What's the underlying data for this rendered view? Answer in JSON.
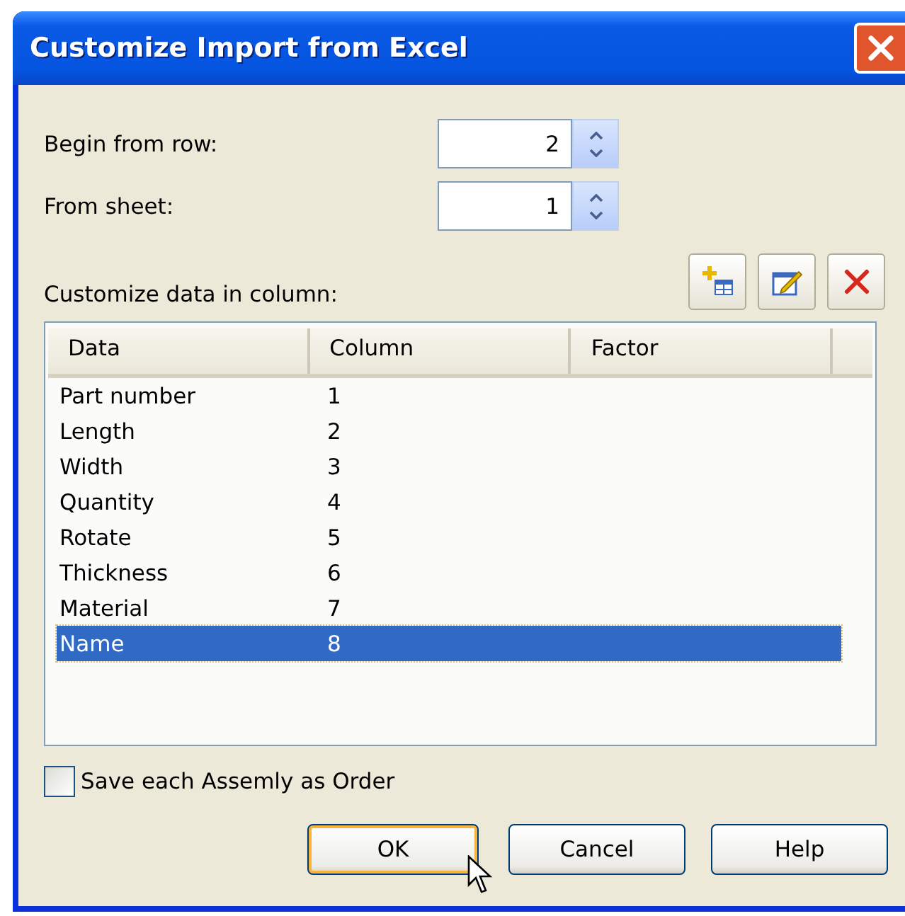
{
  "window": {
    "title": "Customize Import from Excel"
  },
  "fields": [
    {
      "label": "Begin from row:",
      "value": "2"
    },
    {
      "label": "From sheet:",
      "value": "1"
    }
  ],
  "list_label": "Customize data in column:",
  "toolbar": [
    {
      "kind": "add"
    },
    {
      "kind": "edit"
    },
    {
      "kind": "delete"
    }
  ],
  "table": {
    "columns": [
      "Data",
      "Column",
      "Factor"
    ],
    "rows": [
      {
        "cells": [
          "Part number",
          "1"
        ],
        "selected": false
      },
      {
        "cells": [
          "Length",
          "2"
        ],
        "selected": false
      },
      {
        "cells": [
          "Width",
          "3"
        ],
        "selected": false
      },
      {
        "cells": [
          "Quantity",
          "4"
        ],
        "selected": false
      },
      {
        "cells": [
          "Rotate",
          "5"
        ],
        "selected": false
      },
      {
        "cells": [
          "Thickness",
          "6"
        ],
        "selected": false
      },
      {
        "cells": [
          "Material",
          "7"
        ],
        "selected": false
      },
      {
        "cells": [
          "Name",
          "8"
        ],
        "selected": true
      }
    ]
  },
  "checkbox": {
    "label": "Save each Assemly as Order",
    "checked": false
  },
  "buttons": [
    {
      "label": "OK",
      "default": true
    },
    {
      "label": "Cancel",
      "default": false
    },
    {
      "label": "Help",
      "default": false
    }
  ]
}
